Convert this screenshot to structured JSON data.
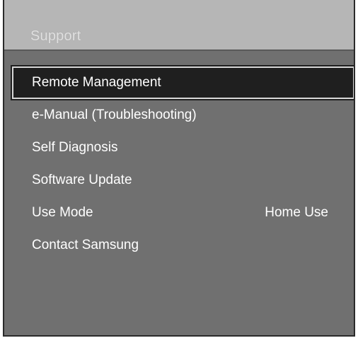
{
  "panel": {
    "title": "Support"
  },
  "menu": {
    "items": [
      {
        "label": "Remote Management",
        "value": "",
        "selected": true
      },
      {
        "label": "e-Manual (Troubleshooting)",
        "value": ""
      },
      {
        "label": "Self Diagnosis",
        "value": ""
      },
      {
        "label": "Software Update",
        "value": ""
      },
      {
        "label": "Use Mode",
        "value": "Home Use"
      },
      {
        "label": "Contact Samsung",
        "value": ""
      }
    ]
  },
  "colors": {
    "panel_background": "#707070",
    "header_background": "#b6b6b6",
    "selection_background": "#1f1f1f",
    "selection_border": "#d8d8d8",
    "text": "#ffffff"
  }
}
